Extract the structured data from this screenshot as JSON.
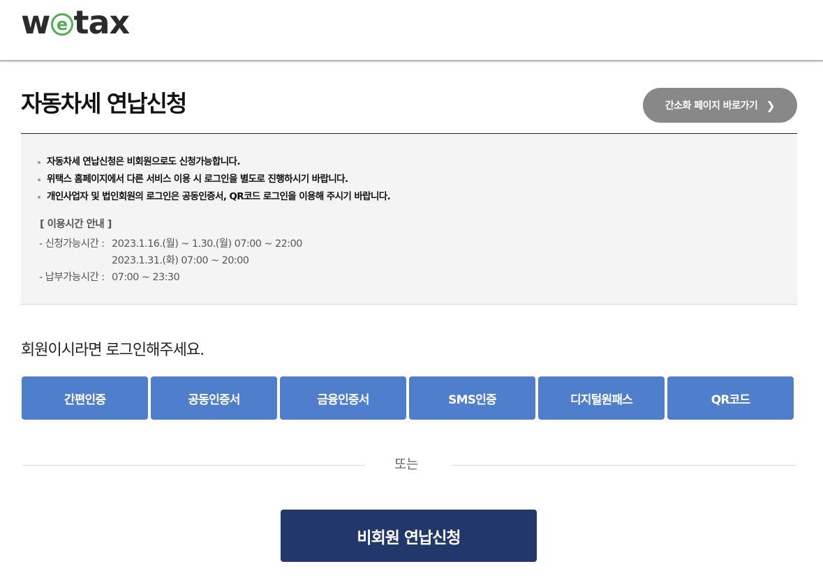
{
  "header": {
    "logo_prefix": "w",
    "logo_e": "e",
    "logo_suffix": "tax",
    "logo_accent": "#4caf50"
  },
  "page": {
    "title": "자동차세 연납신청",
    "simple_page_button": "간소화 페이지 바로가기",
    "simple_page_chevron": "❯"
  },
  "notice": {
    "items": [
      "자동차세 연납신청은 비회원으로도 신청가능합니다.",
      "위택스 홈페이지에서 다른 서비스 이용 시 로그인을 별도로 진행하시기 바랍니다.",
      "개인사업자 및 법인회원의 로그인은 공동인증서, QR코드 로그인을 이용해 주시기 바랍니다."
    ],
    "hours_title": "[ 이용시간 안내 ]",
    "hours": [
      {
        "label": "- 신청가능시간 :",
        "value": "2023.1.16.(월) ~ 1.30.(월) 07:00 ~ 22:00"
      },
      {
        "label": "",
        "value": "2023.1.31.(화) 07:00 ~ 20:00"
      },
      {
        "label": "- 납부가능시간 :",
        "value": "07:00 ~ 23:30"
      }
    ]
  },
  "login": {
    "prompt": "회원이시라면 로그인해주세요.",
    "methods": [
      "간편인증",
      "공동인증서",
      "금융인증서",
      "SMS인증",
      "디지털원패스",
      "QR코드"
    ],
    "button_color": "#4f7fcc"
  },
  "divider": {
    "or_text": "또는"
  },
  "nonmember": {
    "button": "비회원 연납신청",
    "button_color": "#22376b"
  }
}
